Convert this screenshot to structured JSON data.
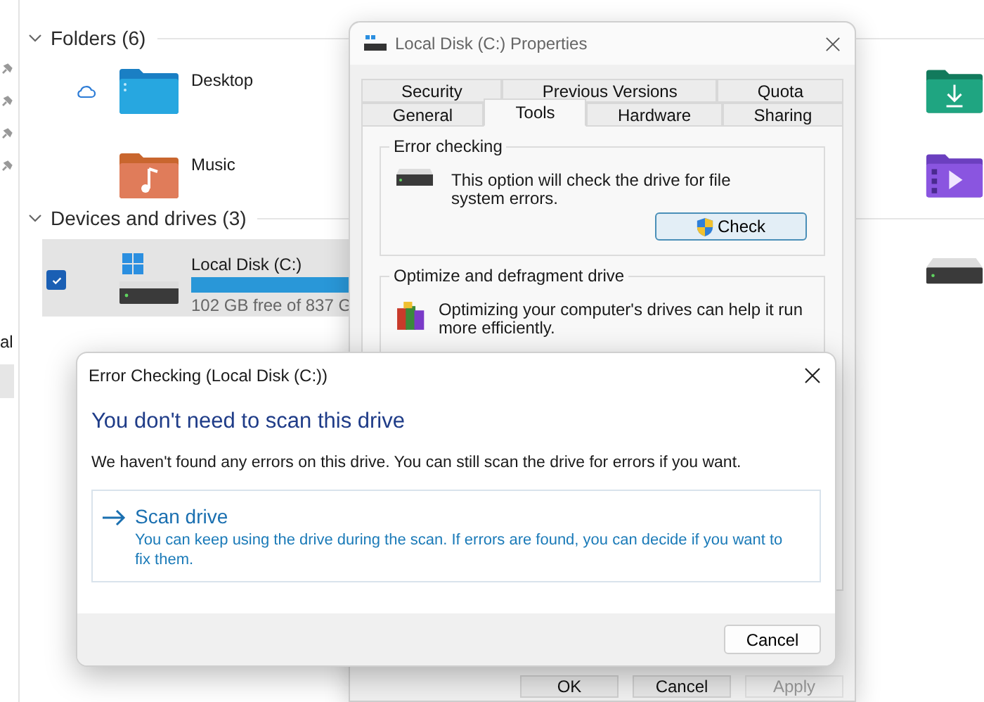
{
  "explorer": {
    "nav_fragment": "al",
    "sections": [
      {
        "title": "Folders (6)",
        "expanded": true,
        "items": [
          {
            "kind": "folder",
            "name": "Desktop",
            "cloud": true
          },
          {
            "kind": "folder",
            "name": "Music",
            "cloud": false
          }
        ]
      },
      {
        "title": "Devices and drives (3)",
        "expanded": true,
        "items": [
          {
            "kind": "drive",
            "name": "Local Disk (C:)",
            "level": 0.88,
            "free": "102 GB free of 837 G",
            "selected": true,
            "checked": true
          }
        ]
      }
    ]
  },
  "properties": {
    "title": "Local Disk (C:) Properties",
    "tab_rows": [
      [
        {
          "label": "Security",
          "selected": false
        },
        {
          "label": "Previous Versions",
          "selected": false
        },
        {
          "label": "Quota",
          "selected": false
        }
      ],
      [
        {
          "label": "General",
          "selected": false
        },
        {
          "label": "Tools",
          "selected": true
        },
        {
          "label": "Hardware",
          "selected": false
        },
        {
          "label": "Sharing",
          "selected": false
        }
      ]
    ],
    "groups": [
      {
        "kind": "check",
        "legend": "Error checking",
        "text": "This option will check the drive for file system errors.",
        "button": "Check"
      },
      {
        "kind": "optimize",
        "legend": "Optimize and defragment drive",
        "text": "Optimizing your computer's drives can help it run more efficiently."
      }
    ],
    "buttons": [
      {
        "label": "OK",
        "disabled": false
      },
      {
        "label": "Cancel",
        "disabled": false
      },
      {
        "label": "Apply",
        "disabled": true
      }
    ]
  },
  "dialog": {
    "title": "Error Checking (Local Disk (C:))",
    "heading": "You don't need to scan this drive",
    "message": "We haven't found any errors on this drive. You can still scan the drive for errors if you want.",
    "option": {
      "title": "Scan drive",
      "description": "You can keep using the drive during the scan. If errors are found, you can decide if you want to fix them."
    },
    "buttons": [
      "Cancel"
    ]
  }
}
